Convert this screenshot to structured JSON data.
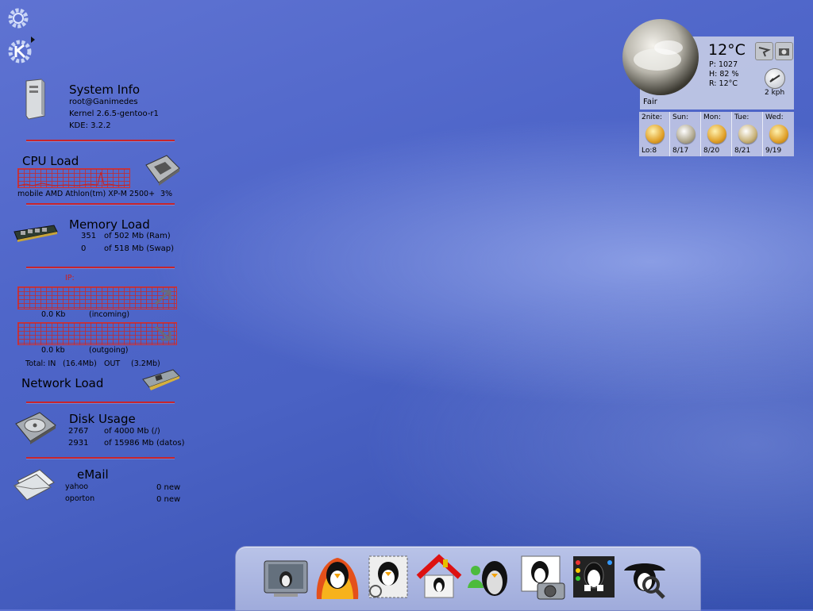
{
  "desktop": {
    "system_info": {
      "title": "System Info",
      "user": "root@Ganimedes",
      "kernel": "Kernel 2.6.5-gentoo-r1",
      "kde": "KDE: 3.2.2"
    },
    "cpu": {
      "title": "CPU Load",
      "model": "mobile AMD Athlon(tm) XP-M 2500+",
      "usage": "3%"
    },
    "memory": {
      "title": "Memory Load",
      "ram_used": "351",
      "ram_total": "of 502 Mb (Ram)",
      "swap_used": "0",
      "swap_total": "of 518 Mb (Swap)"
    },
    "network": {
      "ip_label": "IP:",
      "incoming_value": "0.0 Kb",
      "incoming_label": "(incoming)",
      "outgoing_value": "0.0 kb",
      "outgoing_label": "(outgoing)",
      "total_in_label": "Total: IN",
      "total_in": "(16.4Mb)",
      "total_out_label": "OUT",
      "total_out": "(3.2Mb)",
      "title": "Network Load"
    },
    "disk": {
      "title": "Disk Usage",
      "root_used": "2767",
      "root_total": "of 4000 Mb (/)",
      "datos_used": "2931",
      "datos_total": "of 15986 Mb (datos)"
    },
    "email": {
      "title": "eMail",
      "accounts": [
        {
          "name": "yahoo",
          "count": "0 new"
        },
        {
          "name": "oporton",
          "count": "0 new"
        }
      ]
    },
    "weather": {
      "temperature": "12°C",
      "pressure": "P: 1027",
      "humidity": "H: 82 %",
      "real_feel": "R: 12°C",
      "condition": "Fair",
      "wind": "2 kph",
      "forecast": [
        {
          "day": "2nite:",
          "value": "Lo:8"
        },
        {
          "day": "Sun:",
          "value": "8/17"
        },
        {
          "day": "Mon:",
          "value": "8/20"
        },
        {
          "day": "Tue:",
          "value": "8/21"
        },
        {
          "day": "Wed:",
          "value": "9/19"
        }
      ]
    },
    "dock_icons": [
      "terminal-icon",
      "firefox-penguin-icon",
      "mail-penguin-icon",
      "home-icon",
      "messenger-penguin-icon",
      "photo-penguin-icon",
      "control-panel-penguin-icon",
      "search-penguin-icon"
    ]
  }
}
